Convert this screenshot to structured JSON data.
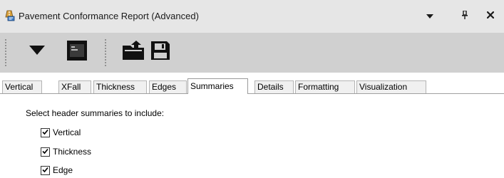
{
  "window": {
    "title": "Pavement Conformance Report (Advanced)",
    "icons": {
      "app": "road-report-icon",
      "dropdown": "dropdown-arrow-icon",
      "pin": "pin-icon",
      "close": "close-icon"
    }
  },
  "toolbar": {
    "items": [
      {
        "icon": "dropdown-arrow-icon"
      },
      {
        "icon": "terminal-icon"
      },
      {
        "icon": "open-folder-icon"
      },
      {
        "icon": "save-icon"
      }
    ]
  },
  "tabs": [
    {
      "label": "Vertical",
      "active": false
    },
    {
      "label": "XFall",
      "active": false
    },
    {
      "label": "Thickness",
      "active": false
    },
    {
      "label": "Edges",
      "active": false
    },
    {
      "label": "Summaries",
      "active": true
    },
    {
      "label": "Details",
      "active": false
    },
    {
      "label": "Formatting",
      "active": false
    },
    {
      "label": "Visualization",
      "active": false
    }
  ],
  "summaries": {
    "prompt": "Select header summaries to include:",
    "options": [
      {
        "label": "Vertical",
        "checked": true
      },
      {
        "label": "Thickness",
        "checked": true
      },
      {
        "label": "Edge",
        "checked": true
      }
    ]
  }
}
